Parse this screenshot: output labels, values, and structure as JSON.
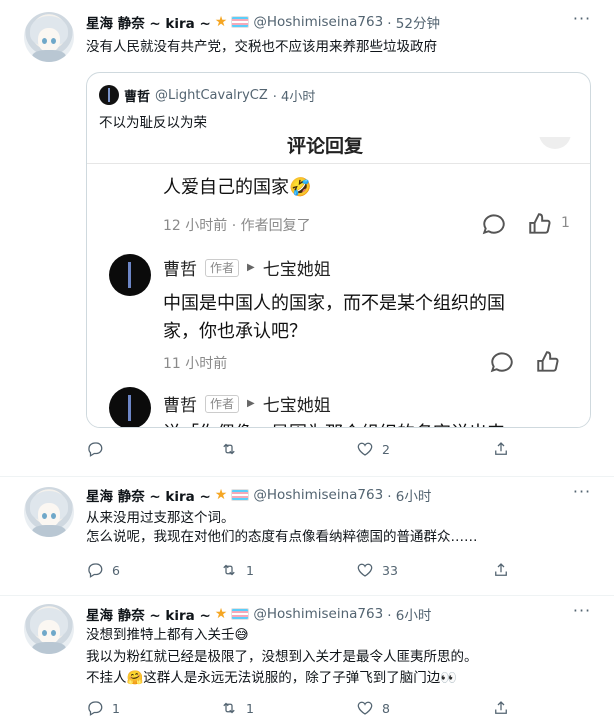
{
  "tweets": [
    {
      "name": "星海 静奈 ~ kira ~",
      "handle": "@Hoshimiseina763",
      "time": "· 52分钟",
      "text": "没有人民就没有共产党，交税也不应该用来养那些垃圾政府",
      "actions": {
        "reply": "",
        "retweet": "",
        "like": "2"
      },
      "quote": {
        "name": "曹哲",
        "handle": "@LightCavalryCZ",
        "time": "· 4小时",
        "text": "不以为耻反以为荣",
        "screenshot": {
          "title": "评论回复",
          "close": "×",
          "line1": "人爱自己的国家🤣",
          "meta1": "12 小时前 · 作者回复了",
          "like1": "1",
          "reply_name": "曹哲",
          "author_tag": "作者",
          "reply_to": "七宝她姐",
          "reply_text1": "中国是中国人的国家，而不是某个组织的国",
          "reply_text2": "家，你也承认吧？",
          "meta2": "11 小时前",
          "reply2_name": "曹哲",
          "reply2_tag": "作者",
          "reply2_to": "七宝她姐",
          "reply2_text": "说「你偶像」是因为那个组织的名字说出来"
        }
      }
    },
    {
      "name": "星海 静奈 ~ kira ~",
      "handle": "@Hoshimiseina763",
      "time": "· 6小时",
      "text_lines": [
        "从来没用过支那这个词。",
        "怎么说呢，我现在对他们的态度有点像看纳粹德国的普通群众……"
      ],
      "actions": {
        "reply": "6",
        "retweet": "1",
        "like": "33"
      }
    },
    {
      "name": "星海 静奈 ~ kira ~",
      "handle": "@Hoshimiseina763",
      "time": "· 6小时",
      "text_lines": [
        "没想到推特上都有入关壬😅",
        "我以为粉红就已经是极限了，没想到入关才是最令人匪夷所思的。",
        "不挂人🤗这群人是永远无法说服的，除了子弹飞到了脑门边👀"
      ],
      "actions": {
        "reply": "1",
        "retweet": "1",
        "like": "8"
      }
    }
  ],
  "icons": {
    "star": "star-icon",
    "flag": "transgender-flag-icon",
    "more": "more-icon"
  }
}
